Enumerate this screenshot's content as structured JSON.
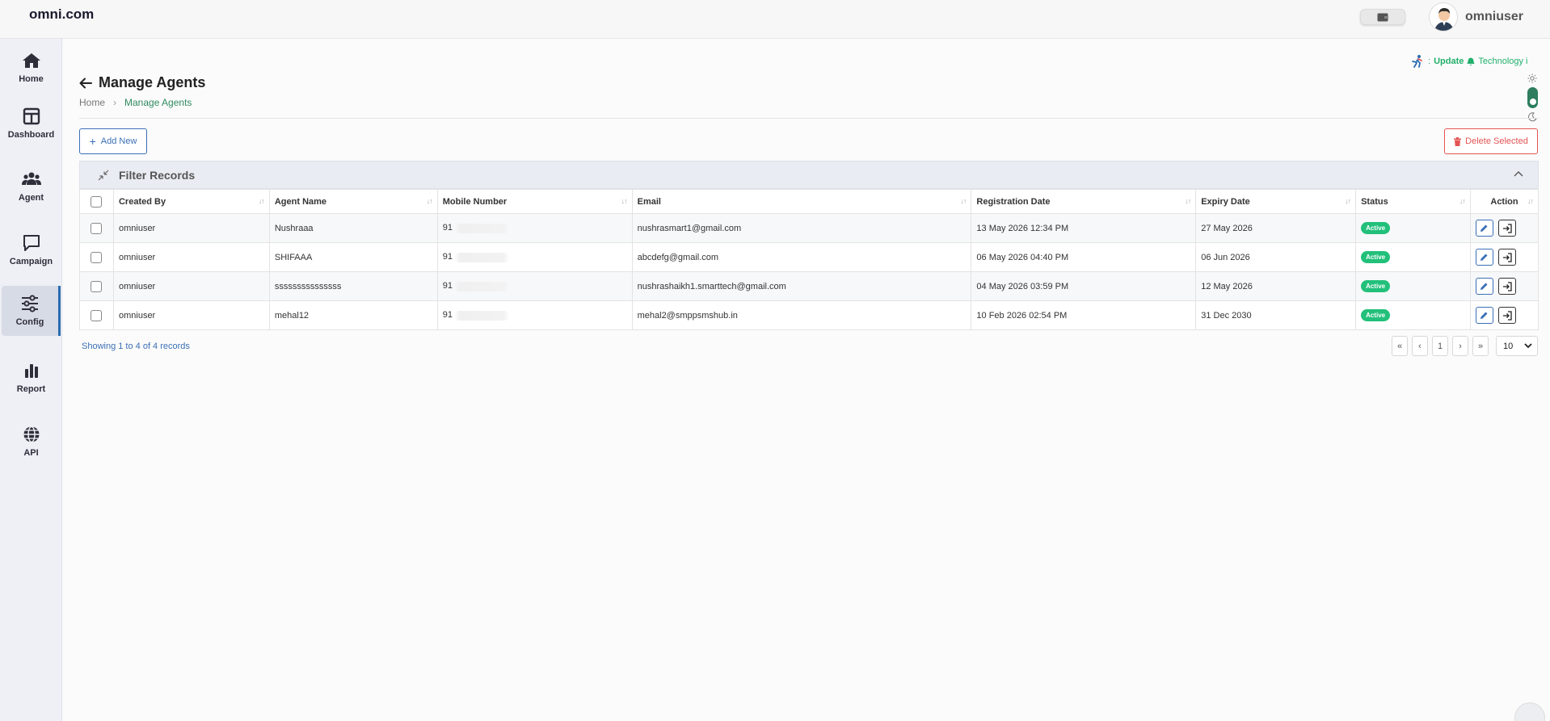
{
  "header": {
    "brand": "omni.com",
    "username": "omniuser"
  },
  "sidebar": {
    "items": [
      {
        "label": "Home",
        "icon": "home-icon"
      },
      {
        "label": "Dashboard",
        "icon": "dashboard-icon"
      },
      {
        "label": "Agent",
        "icon": "users-icon"
      },
      {
        "label": "Campaign",
        "icon": "chat-icon"
      },
      {
        "label": "Config",
        "icon": "sliders-icon",
        "active": true
      },
      {
        "label": "Report",
        "icon": "bar-chart-icon"
      },
      {
        "label": "API",
        "icon": "globe-icon"
      }
    ]
  },
  "status_strip": {
    "prefix": ":",
    "update_label": "Update",
    "ticker_text": "Technology i"
  },
  "page": {
    "title": "Manage Agents",
    "breadcrumb": {
      "home": "Home",
      "current": "Manage Agents"
    }
  },
  "toolbar": {
    "add_label": "Add New",
    "delete_label": "Delete Selected"
  },
  "filter": {
    "title": "Filter Records"
  },
  "table": {
    "columns": [
      "Created By",
      "Agent Name",
      "Mobile Number",
      "Email",
      "Registration Date",
      "Expiry Date",
      "Status",
      "Action"
    ],
    "rows": [
      {
        "created_by": "omniuser",
        "agent_name": "Nushraaa",
        "mobile": "91",
        "email": "nushrasmart1@gmail.com",
        "registration": "13 May 2026 12:34 PM",
        "expiry": "27 May 2026",
        "status": "Active"
      },
      {
        "created_by": "omniuser",
        "agent_name": "SHIFAAA",
        "mobile": "91",
        "email": "abcdefg@gmail.com",
        "registration": "06 May 2026 04:40 PM",
        "expiry": "06 Jun 2026",
        "status": "Active"
      },
      {
        "created_by": "omniuser",
        "agent_name": "sssssssssssssss",
        "mobile": "91",
        "email": "nushrashaikh1.smarttech@gmail.com",
        "registration": "04 May 2026 03:59 PM",
        "expiry": "12 May 2026",
        "status": "Active"
      },
      {
        "created_by": "omniuser",
        "agent_name": "mehal12",
        "mobile": "91",
        "email": "mehal2@smppsmshub.in",
        "registration": "10 Feb 2026 02:54 PM",
        "expiry": "31 Dec 2030",
        "status": "Active"
      }
    ]
  },
  "footer": {
    "showing_text": "Showing 1 to 4 of 4 records",
    "pager": {
      "first": "«",
      "prev": "‹",
      "current": "1",
      "next": "›",
      "last": "»"
    },
    "per_page": "10"
  },
  "colors": {
    "accent_blue": "#3b6fb6",
    "accent_green": "#2f8a5f",
    "status_active": "#22c07a",
    "danger": "#e35454"
  }
}
